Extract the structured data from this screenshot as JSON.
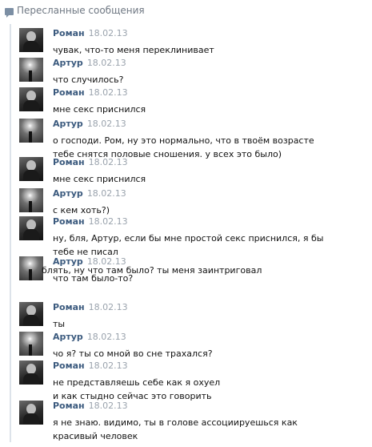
{
  "header": {
    "title": "Пересланные сообщения",
    "icon": "message-bubble-icon"
  },
  "messages": [
    {
      "author": "Роман",
      "date": "18.02.13",
      "avatar": "roman",
      "lines": [
        "чувак, что-то меня переклинивает"
      ]
    },
    {
      "author": "Артур",
      "date": "18.02.13",
      "avatar": "artur",
      "lines": [
        "что случилось?"
      ]
    },
    {
      "author": "Роман",
      "date": "18.02.13",
      "avatar": "roman",
      "lines": [
        "мне секс приснился"
      ]
    },
    {
      "author": "Артур",
      "date": "18.02.13",
      "avatar": "artur",
      "lines": [
        "о господи. Ром, ну это нормально, что в твоём возрасте",
        "тебе снятся половые сношения. у всех это было)"
      ]
    },
    {
      "author": "Роман",
      "date": "18.02.13",
      "avatar": "roman",
      "lines": [
        "мне секс приснился"
      ]
    },
    {
      "author": "Артур",
      "date": "18.02.13",
      "avatar": "artur",
      "lines": [
        "с кем хоть?)"
      ]
    },
    {
      "author": "Роман",
      "date": "18.02.13",
      "avatar": "roman",
      "lines": [
        "ну, бля, Артур, если бы мне простой секс приснился, я бы",
        "тебе не писал"
      ]
    },
    {
      "author": "Артур",
      "date": "18.02.13",
      "avatar": "artur",
      "lines": [
        "что там было-то?"
      ]
    },
    {
      "author": "Роман",
      "date": "18.02.13",
      "avatar": "roman",
      "lines": [
        "ты"
      ]
    },
    {
      "author": "Артур",
      "date": "18.02.13",
      "avatar": "artur",
      "lines": [
        "чо я? ты со мной во сне трахался?"
      ]
    },
    {
      "author": "Роман",
      "date": "18.02.13",
      "avatar": "roman",
      "lines": [
        "не представляешь себе как я охуел",
        "и как стыдно сейчас это говорить"
      ]
    },
    {
      "author": "Роман",
      "date": "18.02.13",
      "avatar": "roman",
      "lines": [
        "я не знаю. видимо, ты в голове ассоциируешься как",
        "красивый человек"
      ]
    }
  ],
  "continuation": "блять, ну что там было? ты меня заинтриговал"
}
